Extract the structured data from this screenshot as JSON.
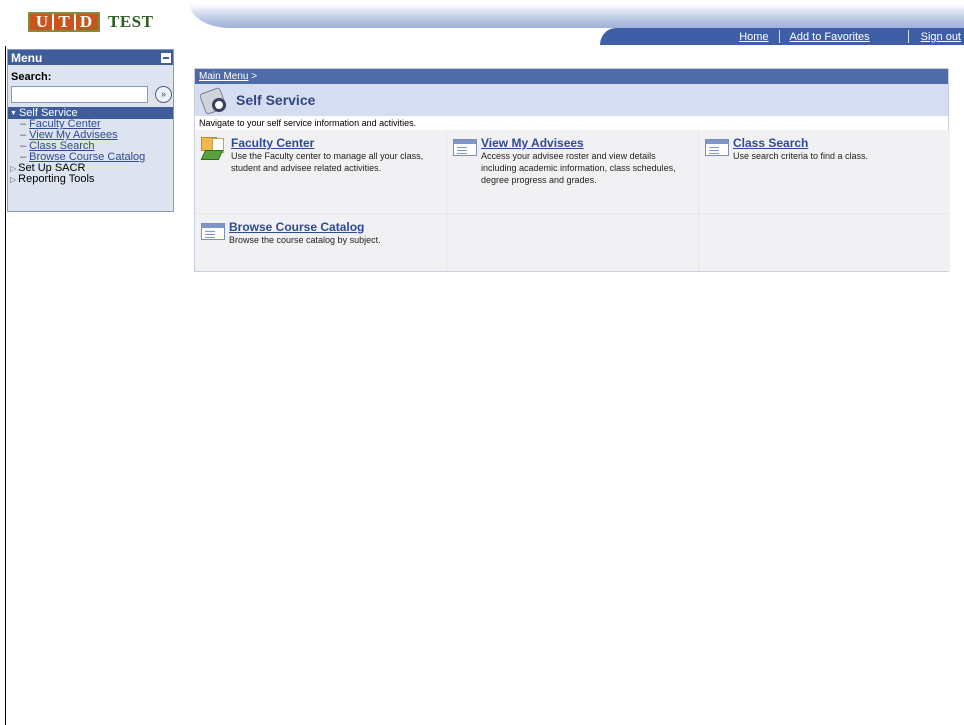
{
  "header": {
    "logo_letters": [
      "U",
      "T",
      "D"
    ],
    "logo_test": "TEST",
    "nav": [
      {
        "label": "Home"
      },
      {
        "label": "Add to Favorites"
      },
      {
        "label": "Sign out"
      }
    ]
  },
  "menu": {
    "title": "Menu",
    "search_label": "Search:",
    "search_value": "",
    "expanded_folder": "Self Service",
    "sub_items": [
      {
        "label": "Faculty Center"
      },
      {
        "label": "View My Advisees"
      },
      {
        "label": "Class Search"
      },
      {
        "label": "Browse Course Catalog"
      }
    ],
    "folders": [
      {
        "label": "Set Up SACR"
      },
      {
        "label": "Reporting Tools"
      }
    ]
  },
  "main": {
    "breadcrumb": "Main Menu",
    "breadcrumb_sep": ">",
    "title": "Self Service",
    "subtitle": "Navigate to your self service information and activities.",
    "tiles": [
      {
        "title": "Faculty Center",
        "desc": "Use the Faculty center to manage all your class, student and advisee related activities.",
        "icon": "faculty-center-icon"
      },
      {
        "title": "View My Advisees",
        "desc": "Access your advisee roster and view details including academic information, class schedules, degree progress and grades.",
        "icon": "page-icon"
      },
      {
        "title": "Class Search",
        "desc": "Use search criteria to find a class.",
        "icon": "page-icon"
      },
      {
        "title": "Browse Course Catalog",
        "desc": "Browse the course catalog by subject.",
        "icon": "page-icon"
      }
    ]
  },
  "colors": {
    "menu_header": "#3f5d9a",
    "link": "#2e4a94",
    "breadcrumb_bar": "#4e6aa8",
    "title_bar": "#d5ddf0",
    "logo_orange": "#c9541d",
    "logo_green": "#2f5d1f"
  }
}
